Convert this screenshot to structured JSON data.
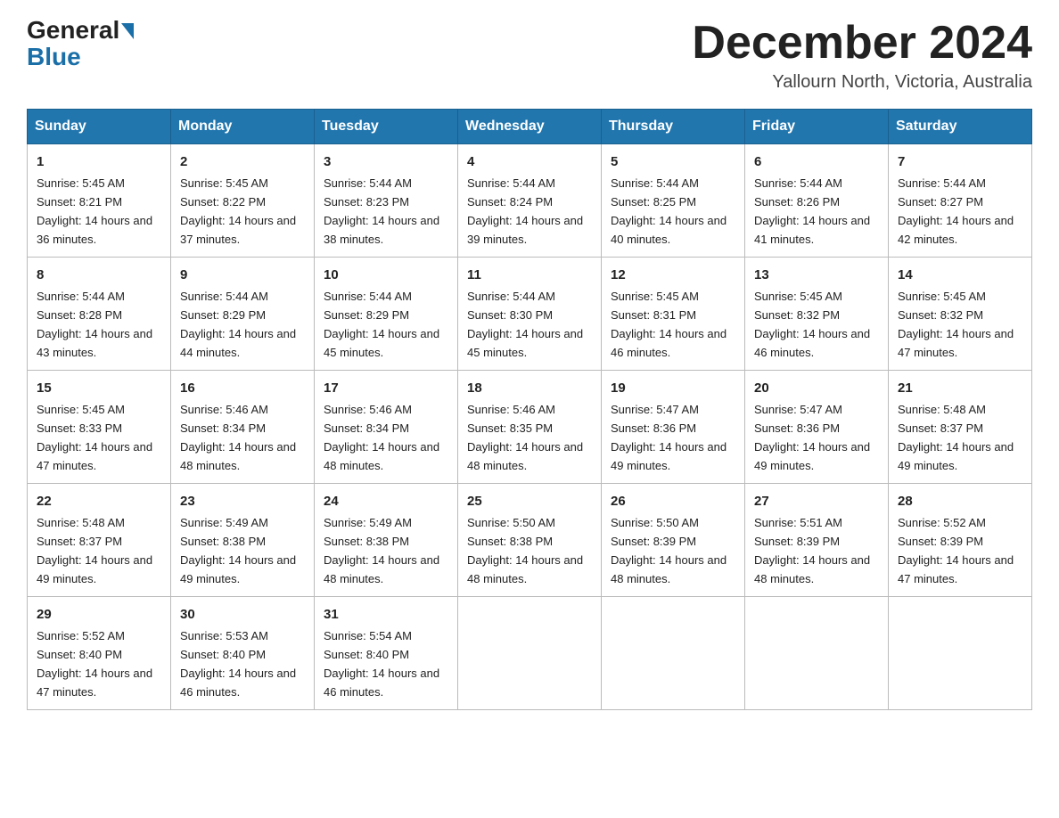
{
  "header": {
    "logo_general": "General",
    "logo_blue": "Blue",
    "title": "December 2024",
    "subtitle": "Yallourn North, Victoria, Australia"
  },
  "days_of_week": [
    "Sunday",
    "Monday",
    "Tuesday",
    "Wednesday",
    "Thursday",
    "Friday",
    "Saturday"
  ],
  "weeks": [
    [
      {
        "day": "1",
        "sunrise": "5:45 AM",
        "sunset": "8:21 PM",
        "daylight": "14 hours and 36 minutes."
      },
      {
        "day": "2",
        "sunrise": "5:45 AM",
        "sunset": "8:22 PM",
        "daylight": "14 hours and 37 minutes."
      },
      {
        "day": "3",
        "sunrise": "5:44 AM",
        "sunset": "8:23 PM",
        "daylight": "14 hours and 38 minutes."
      },
      {
        "day": "4",
        "sunrise": "5:44 AM",
        "sunset": "8:24 PM",
        "daylight": "14 hours and 39 minutes."
      },
      {
        "day": "5",
        "sunrise": "5:44 AM",
        "sunset": "8:25 PM",
        "daylight": "14 hours and 40 minutes."
      },
      {
        "day": "6",
        "sunrise": "5:44 AM",
        "sunset": "8:26 PM",
        "daylight": "14 hours and 41 minutes."
      },
      {
        "day": "7",
        "sunrise": "5:44 AM",
        "sunset": "8:27 PM",
        "daylight": "14 hours and 42 minutes."
      }
    ],
    [
      {
        "day": "8",
        "sunrise": "5:44 AM",
        "sunset": "8:28 PM",
        "daylight": "14 hours and 43 minutes."
      },
      {
        "day": "9",
        "sunrise": "5:44 AM",
        "sunset": "8:29 PM",
        "daylight": "14 hours and 44 minutes."
      },
      {
        "day": "10",
        "sunrise": "5:44 AM",
        "sunset": "8:29 PM",
        "daylight": "14 hours and 45 minutes."
      },
      {
        "day": "11",
        "sunrise": "5:44 AM",
        "sunset": "8:30 PM",
        "daylight": "14 hours and 45 minutes."
      },
      {
        "day": "12",
        "sunrise": "5:45 AM",
        "sunset": "8:31 PM",
        "daylight": "14 hours and 46 minutes."
      },
      {
        "day": "13",
        "sunrise": "5:45 AM",
        "sunset": "8:32 PM",
        "daylight": "14 hours and 46 minutes."
      },
      {
        "day": "14",
        "sunrise": "5:45 AM",
        "sunset": "8:32 PM",
        "daylight": "14 hours and 47 minutes."
      }
    ],
    [
      {
        "day": "15",
        "sunrise": "5:45 AM",
        "sunset": "8:33 PM",
        "daylight": "14 hours and 47 minutes."
      },
      {
        "day": "16",
        "sunrise": "5:46 AM",
        "sunset": "8:34 PM",
        "daylight": "14 hours and 48 minutes."
      },
      {
        "day": "17",
        "sunrise": "5:46 AM",
        "sunset": "8:34 PM",
        "daylight": "14 hours and 48 minutes."
      },
      {
        "day": "18",
        "sunrise": "5:46 AM",
        "sunset": "8:35 PM",
        "daylight": "14 hours and 48 minutes."
      },
      {
        "day": "19",
        "sunrise": "5:47 AM",
        "sunset": "8:36 PM",
        "daylight": "14 hours and 49 minutes."
      },
      {
        "day": "20",
        "sunrise": "5:47 AM",
        "sunset": "8:36 PM",
        "daylight": "14 hours and 49 minutes."
      },
      {
        "day": "21",
        "sunrise": "5:48 AM",
        "sunset": "8:37 PM",
        "daylight": "14 hours and 49 minutes."
      }
    ],
    [
      {
        "day": "22",
        "sunrise": "5:48 AM",
        "sunset": "8:37 PM",
        "daylight": "14 hours and 49 minutes."
      },
      {
        "day": "23",
        "sunrise": "5:49 AM",
        "sunset": "8:38 PM",
        "daylight": "14 hours and 49 minutes."
      },
      {
        "day": "24",
        "sunrise": "5:49 AM",
        "sunset": "8:38 PM",
        "daylight": "14 hours and 48 minutes."
      },
      {
        "day": "25",
        "sunrise": "5:50 AM",
        "sunset": "8:38 PM",
        "daylight": "14 hours and 48 minutes."
      },
      {
        "day": "26",
        "sunrise": "5:50 AM",
        "sunset": "8:39 PM",
        "daylight": "14 hours and 48 minutes."
      },
      {
        "day": "27",
        "sunrise": "5:51 AM",
        "sunset": "8:39 PM",
        "daylight": "14 hours and 48 minutes."
      },
      {
        "day": "28",
        "sunrise": "5:52 AM",
        "sunset": "8:39 PM",
        "daylight": "14 hours and 47 minutes."
      }
    ],
    [
      {
        "day": "29",
        "sunrise": "5:52 AM",
        "sunset": "8:40 PM",
        "daylight": "14 hours and 47 minutes."
      },
      {
        "day": "30",
        "sunrise": "5:53 AM",
        "sunset": "8:40 PM",
        "daylight": "14 hours and 46 minutes."
      },
      {
        "day": "31",
        "sunrise": "5:54 AM",
        "sunset": "8:40 PM",
        "daylight": "14 hours and 46 minutes."
      },
      null,
      null,
      null,
      null
    ]
  ]
}
